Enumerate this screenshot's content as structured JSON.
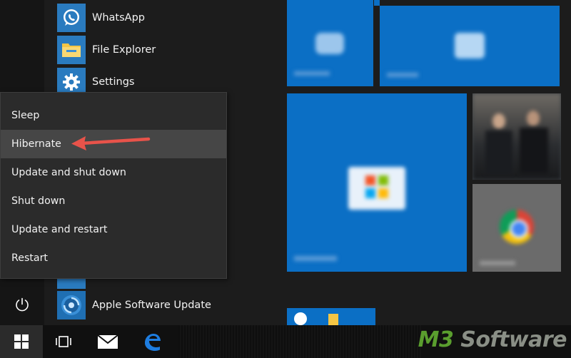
{
  "apps": [
    {
      "label": "WhatsApp",
      "icon": "whatsapp-icon"
    },
    {
      "label": "File Explorer",
      "icon": "folder-icon"
    },
    {
      "label": "Settings",
      "icon": "gear-icon"
    },
    {
      "label": "Apple Software Update",
      "icon": "apple-update-icon"
    }
  ],
  "power_menu": {
    "items": [
      "Sleep",
      "Hibernate",
      "Update and shut down",
      "Shut down",
      "Update and restart",
      "Restart"
    ],
    "highlighted": "Hibernate"
  },
  "taskbar": {
    "buttons": [
      "start-windows-icon",
      "task-view-icon",
      "mail-icon",
      "edge-icon"
    ]
  },
  "watermark": {
    "prefix": "M3",
    "suffix": " Software"
  },
  "colors": {
    "tile_blue": "#0b6fc5",
    "menu_bg": "#2b2b2b",
    "highlight": "#464646",
    "arrow": "#e8534a",
    "watermark_green": "#5a9e2e"
  }
}
